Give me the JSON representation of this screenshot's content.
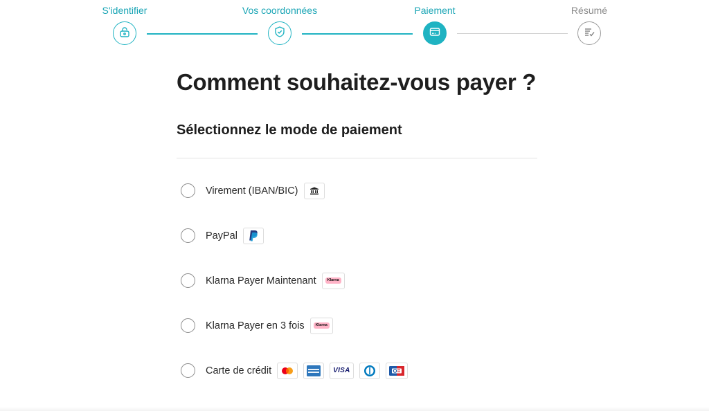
{
  "stepper": {
    "steps": [
      {
        "label": "S'identifier",
        "icon": "lock-icon",
        "state": "done"
      },
      {
        "label": "Vos coordonnées",
        "icon": "shield-check-icon",
        "state": "done"
      },
      {
        "label": "Paiement",
        "icon": "credit-card-icon",
        "state": "active"
      },
      {
        "label": "Résumé",
        "icon": "document-check-icon",
        "state": "future"
      }
    ],
    "accent_color": "#1fb3c2",
    "inactive_color": "#9a9a9a"
  },
  "main": {
    "title": "Comment souhaitez-vous payer ?",
    "section_title": "Sélectionnez le mode de paiement",
    "methods": [
      {
        "label": "Virement (IBAN/BIC)",
        "icons": [
          "bank-icon"
        ],
        "selected": false
      },
      {
        "label": "PayPal",
        "icons": [
          "paypal-icon"
        ],
        "selected": false
      },
      {
        "label": "Klarna Payer Maintenant",
        "icons": [
          "klarna-icon"
        ],
        "selected": false
      },
      {
        "label": "Klarna Payer en 3 fois",
        "icons": [
          "klarna-icon"
        ],
        "selected": false
      },
      {
        "label": "Carte de crédit",
        "icons": [
          "mastercard-icon",
          "amex-icon",
          "visa-icon",
          "diners-icon",
          "cb-icon"
        ],
        "selected": false
      }
    ],
    "klarna_badge_text": "Klarna",
    "visa_badge_text": "VISA"
  }
}
